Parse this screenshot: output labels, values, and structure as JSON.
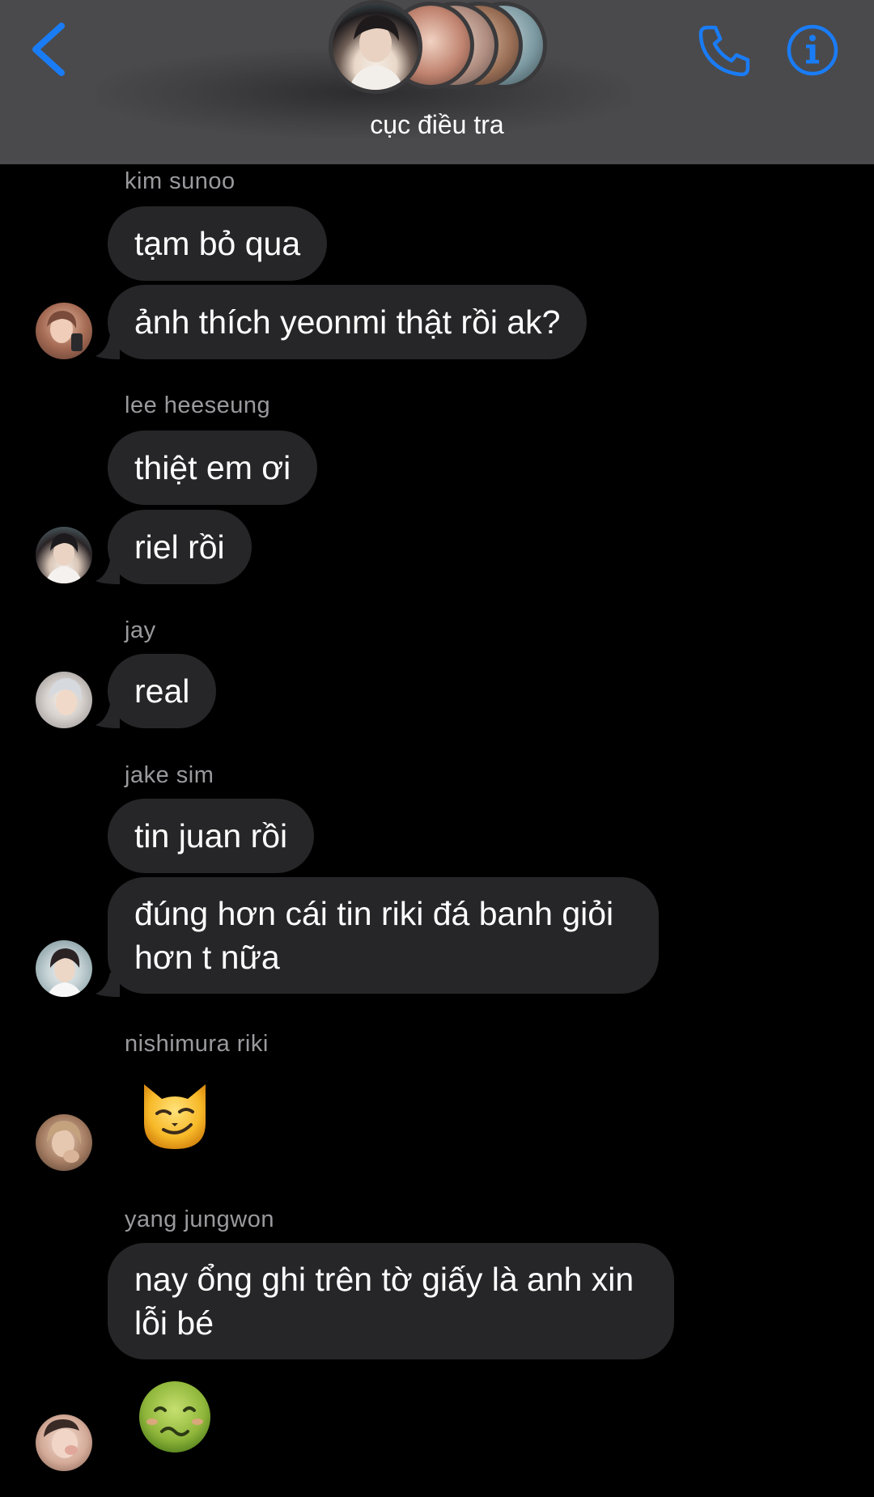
{
  "header": {
    "title": "cục điều tra",
    "back_icon": "chevron-left-icon",
    "call_icon": "phone-icon",
    "info_icon": "info-icon",
    "accent_color": "#1a7cf5",
    "background_color": "#4a4a4c"
  },
  "messages": {
    "sunoo_name": "kim sunoo",
    "sunoo_msg1": "tạm bỏ qua",
    "sunoo_msg2": "ảnh thích yeonmi thật rồi ak?",
    "heeseung_name": "lee heeseung",
    "heeseung_msg1": "thiệt em ơi",
    "heeseung_msg2": "riel rồi",
    "jay_name": "jay",
    "jay_msg1": "real",
    "jake_name": "jake sim",
    "jake_msg1": "tin juan rồi",
    "jake_msg2": "đúng hơn cái tin riki đá banh giỏi hơn t nữa",
    "riki_name": "nishimura riki",
    "riki_emoji": "smirking-cat-emoji",
    "jungwon_name": "yang jungwon",
    "jungwon_msg1": "nay ổng ghi trên tờ giấy là anh xin lỗi bé",
    "jungwon_emoji": "nauseated-face-emoji"
  },
  "colors": {
    "bubble": "#262628",
    "sender_name": "#9a9a9e",
    "background": "#000000"
  }
}
